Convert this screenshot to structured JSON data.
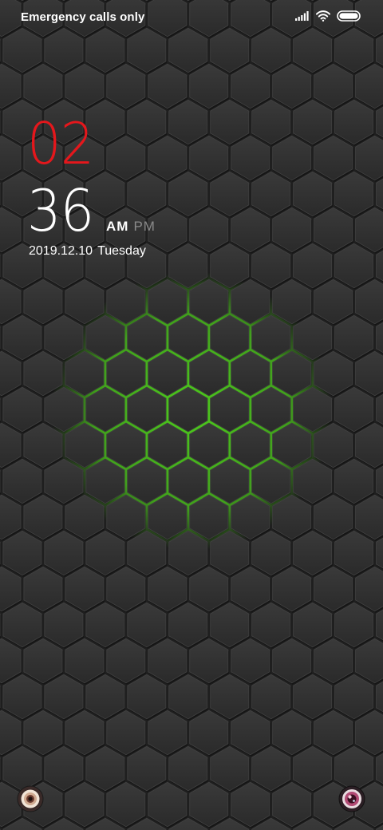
{
  "status_bar": {
    "carrier_text": "Emergency calls only",
    "icons": [
      "signal-icon",
      "wifi-icon",
      "battery-icon"
    ]
  },
  "clock": {
    "hour": "02",
    "minute": "36",
    "am_label": "AM",
    "pm_label": "PM",
    "active_period": "AM",
    "date": "2019.12.10",
    "weekday": "Tuesday"
  },
  "shortcuts": {
    "left": "lens-shortcut-icon",
    "right": "camera-shortcut-icon"
  },
  "colors": {
    "hour": "#e5171c",
    "minute": "#ffffff",
    "background": "#2b2b2b",
    "hex_glow": "#4ecb1e",
    "pm_inactive": "#8a8a8a"
  },
  "wallpaper": {
    "pattern": "hexagon-honeycomb",
    "glow_color": "#4ecb1e"
  }
}
